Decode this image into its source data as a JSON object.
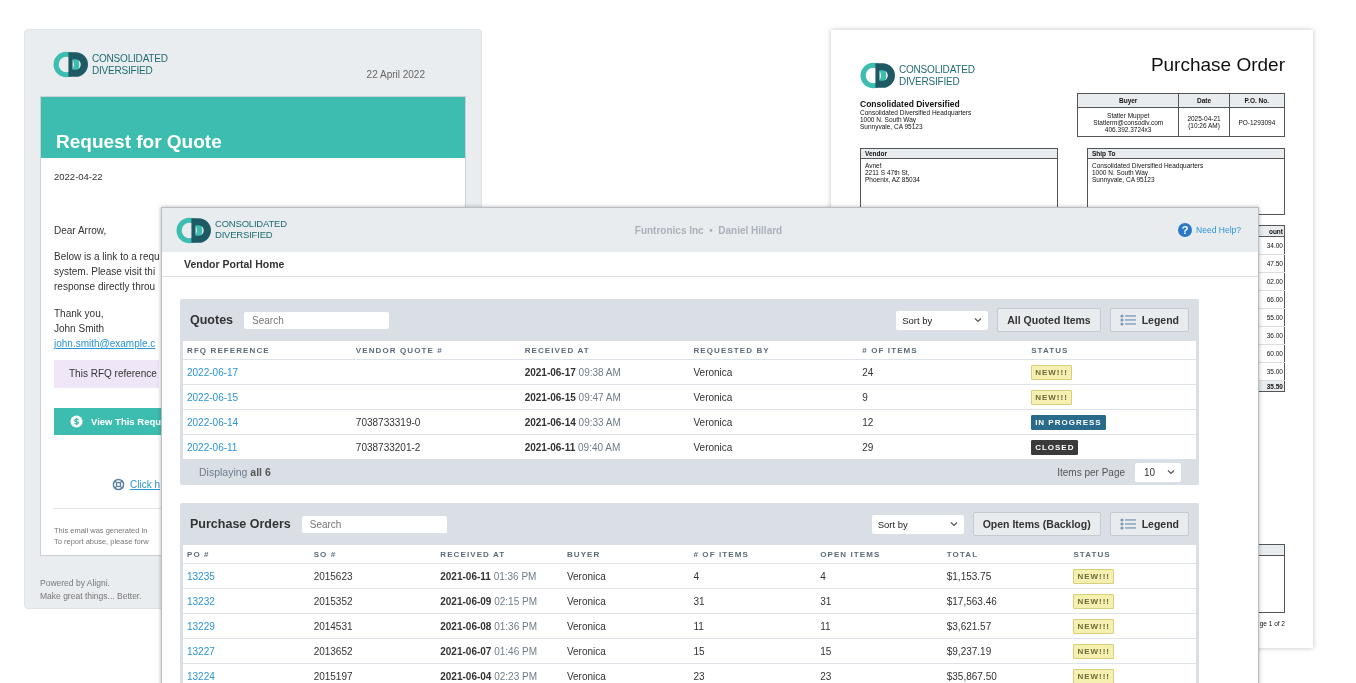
{
  "email": {
    "logo": [
      "CONSOLIDATED",
      "DIVERSIFIED"
    ],
    "date": "22 April 2022",
    "title": "Request for Quote",
    "sent_date": "2022-04-22",
    "greeting": "Dear Arrow,",
    "body_lines": [
      "Below is a link to a requ",
      "system. Please visit thi",
      "response directly throu"
    ],
    "signoff": [
      "Thank you,",
      "John Smith"
    ],
    "email_link": "john.smith@example.c",
    "notice": "This RFQ reference",
    "button": "View This Requ",
    "help_link": "Click h",
    "footer_lines": [
      "This email was generated in",
      "To report abuse, please forw"
    ],
    "powered_by": [
      "Powered by Aligni.",
      "Make great things... Better."
    ]
  },
  "purchase_order": {
    "logo": [
      "CONSOLIDATED",
      "DIVERSIFIED"
    ],
    "title": "Purchase Order",
    "company": "Consolidated Diversified",
    "company_address": [
      "Consolidated Diversified Headquarters",
      "1000 N. South Way",
      "Sunnyvale, CA 95123"
    ],
    "info_table": {
      "columns": [
        "Buyer",
        "Date",
        "P.O. No."
      ],
      "cells": [
        [
          "Statler Muppet",
          "Statlerm@consodiv.com",
          "406.392.3724x3"
        ],
        [
          "2025-04-21",
          "(10:26 AM)"
        ],
        [
          "PO-1293094"
        ]
      ]
    },
    "vendor": {
      "heading": "Vendor",
      "lines": [
        "Avnet",
        "2211 S 47th St,",
        "Phoenix, AZ 85034"
      ]
    },
    "ship_to": {
      "heading": "Ship To",
      "lines": [
        "Consolidated Diversified Headquarters",
        "1000 N. South Way",
        "Sunnyvale, CA 95123"
      ]
    },
    "amounts": {
      "heading": "ount",
      "values": [
        "34.00",
        "47.50",
        "02.00",
        "66.00",
        "55.00",
        "36.00",
        "60.00",
        "35.00"
      ],
      "total": "35.50"
    },
    "page_label": "ge 1 of 2"
  },
  "portal": {
    "logo": [
      "CONSOLIDATED",
      "DIVERSIFIED"
    ],
    "account": "Funtronics Inc  •  Daniel Hillard",
    "help_icon": "?",
    "help": "Need Help?",
    "nav": "Vendor Portal Home",
    "panels": [
      {
        "title": "Quotes",
        "search_placeholder": "Search",
        "sort_placeholder": "Sort by",
        "action": "All Quoted Items",
        "legend": "Legend",
        "columns": [
          {
            "label": "RFQ REFERENCE",
            "kind": "link"
          },
          {
            "label": "VENDOR QUOTE #",
            "kind": "text"
          },
          {
            "label": "RECEIVED AT",
            "kind": "datetime"
          },
          {
            "label": "REQUESTED BY",
            "kind": "text"
          },
          {
            "label": "# OF ITEMS",
            "kind": "text"
          },
          {
            "label": "STATUS",
            "kind": "status"
          }
        ],
        "rows": [
          {
            "cells": [
              "2022-06-17",
              null,
              "**2021-06-17** 09:38 AM",
              "Veronica",
              "24"
            ],
            "status": {
              "label": "NEW!!!",
              "kind": "new"
            }
          },
          {
            "cells": [
              "2022-06-15",
              null,
              "**2021-06-15** 09:47 AM",
              "Veronica",
              "9"
            ],
            "status": {
              "label": "NEW!!!",
              "kind": "new"
            }
          },
          {
            "cells": [
              "2022-06-14",
              "7038733319-0",
              "**2021-06-14** 09:33 AM",
              "Veronica",
              "12"
            ],
            "status": {
              "label": "IN PROGRESS",
              "kind": "progress"
            }
          },
          {
            "cells": [
              "2022-06-11",
              "7038733201-2",
              "**2021-06-11** 09:40 AM",
              "Veronica",
              "29"
            ],
            "status": {
              "label": "CLOSED",
              "kind": "closed"
            }
          }
        ],
        "footer": {
          "displaying": "Displaying **all 6**",
          "per_page_label": "Items per Page",
          "per_page": "10"
        }
      },
      {
        "title": "Purchase Orders",
        "search_placeholder": "Search",
        "sort_placeholder": "Sort by",
        "action": "Open Items (Backlog)",
        "legend": "Legend",
        "columns": [
          {
            "label": "PO #",
            "kind": "link"
          },
          {
            "label": "SO #",
            "kind": "text"
          },
          {
            "label": "RECEIVED AT",
            "kind": "datetime"
          },
          {
            "label": "BUYER",
            "kind": "text"
          },
          {
            "label": "# OF ITEMS",
            "kind": "text"
          },
          {
            "label": "OPEN ITEMS",
            "kind": "text"
          },
          {
            "label": "TOTAL",
            "kind": "text"
          },
          {
            "label": "STATUS",
            "kind": "status"
          }
        ],
        "rows": [
          {
            "cells": [
              "13235",
              "2015623",
              "**2021-06-11** 01:36 PM",
              "Veronica",
              "4",
              "4",
              "$1,153.75"
            ],
            "status": {
              "label": "NEW!!!",
              "kind": "new"
            }
          },
          {
            "cells": [
              "13232",
              "2015352",
              "**2021-06-09** 02:15 PM",
              "Veronica",
              "31",
              "31",
              "$17,563.46"
            ],
            "status": {
              "label": "NEW!!!",
              "kind": "new"
            }
          },
          {
            "cells": [
              "13229",
              "2014531",
              "**2021-06-08** 01:36 PM",
              "Veronica",
              "11",
              "11",
              "$3,621.57"
            ],
            "status": {
              "label": "NEW!!!",
              "kind": "new"
            }
          },
          {
            "cells": [
              "13227",
              "2013652",
              "**2021-06-07** 01:46 PM",
              "Veronica",
              "15",
              "15",
              "$9,237.19"
            ],
            "status": {
              "label": "NEW!!!",
              "kind": "new"
            }
          },
          {
            "cells": [
              "13224",
              "2015197",
              "**2021-06-04** 02:23 PM",
              "Veronica",
              "23",
              "23",
              "$35,867.50"
            ],
            "status": {
              "label": "NEW!!!",
              "kind": "new"
            }
          }
        ]
      }
    ]
  }
}
